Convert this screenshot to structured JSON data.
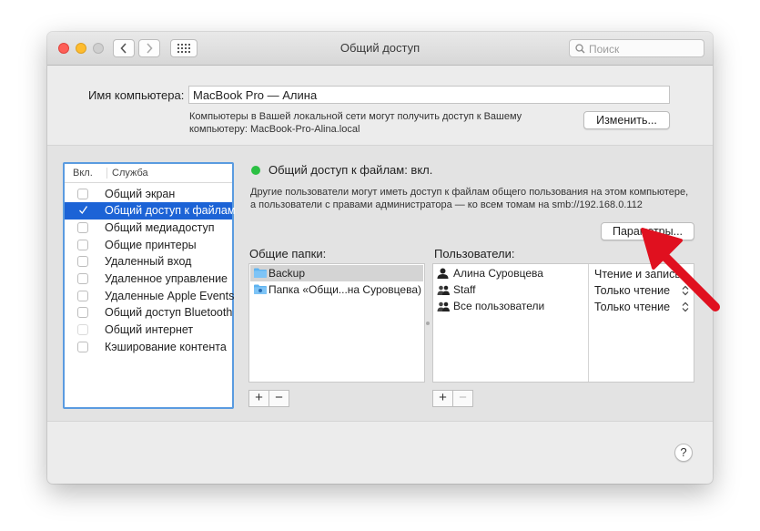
{
  "window": {
    "title": "Общий доступ"
  },
  "search": {
    "placeholder": "Поиск"
  },
  "computer_name": {
    "label": "Имя компьютера:",
    "value": "MacBook Pro — Алина",
    "description_line1": "Компьютеры в Вашей локальной сети могут получить доступ к Вашему",
    "description_line2": "компьютеру: MacBook-Pro-Alina.local",
    "edit_button": "Изменить..."
  },
  "services": {
    "header_on": "Вкл.",
    "header_service": "Служба",
    "items": [
      {
        "name": "Общий экран",
        "checked": false,
        "disabled": false,
        "selected": false
      },
      {
        "name": "Общий доступ к файлам",
        "checked": true,
        "disabled": false,
        "selected": true
      },
      {
        "name": "Общий медиадоступ",
        "checked": false,
        "disabled": false,
        "selected": false
      },
      {
        "name": "Общие принтеры",
        "checked": false,
        "disabled": false,
        "selected": false
      },
      {
        "name": "Удаленный вход",
        "checked": false,
        "disabled": false,
        "selected": false
      },
      {
        "name": "Удаленное управление",
        "checked": false,
        "disabled": false,
        "selected": false
      },
      {
        "name": "Удаленные Apple Events",
        "checked": false,
        "disabled": false,
        "selected": false
      },
      {
        "name": "Общий доступ Bluetooth",
        "checked": false,
        "disabled": false,
        "selected": false
      },
      {
        "name": "Общий интернет",
        "checked": false,
        "disabled": true,
        "selected": false
      },
      {
        "name": "Кэширование контента",
        "checked": false,
        "disabled": false,
        "selected": false
      }
    ]
  },
  "file_sharing": {
    "status": "Общий доступ к файлам: вкл.",
    "status_color": "#2bc043",
    "description_line1": "Другие пользователи могут иметь доступ к файлам общего пользования на этом компьютере,",
    "description_line2": "а пользователи с правами администратора — ко всем томам на smb://192.168.0.112",
    "options_button": "Параметры..."
  },
  "shared_folders": {
    "label": "Общие папки:",
    "items": [
      "Backup",
      "Папка «Общи...на Суровцева)"
    ]
  },
  "users": {
    "label": "Пользователи:",
    "items": [
      {
        "name": "Алина Суровцева",
        "icon": "person-icon",
        "permission": "Чтение и запись"
      },
      {
        "name": "Staff",
        "icon": "group-icon",
        "permission": "Только чтение"
      },
      {
        "name": "Все пользователи",
        "icon": "group-icon",
        "permission": "Только чтение"
      }
    ]
  },
  "controls": {
    "add": "+",
    "remove": "−",
    "help": "?"
  },
  "annotation": {
    "arrow_color": "#e0101f"
  }
}
